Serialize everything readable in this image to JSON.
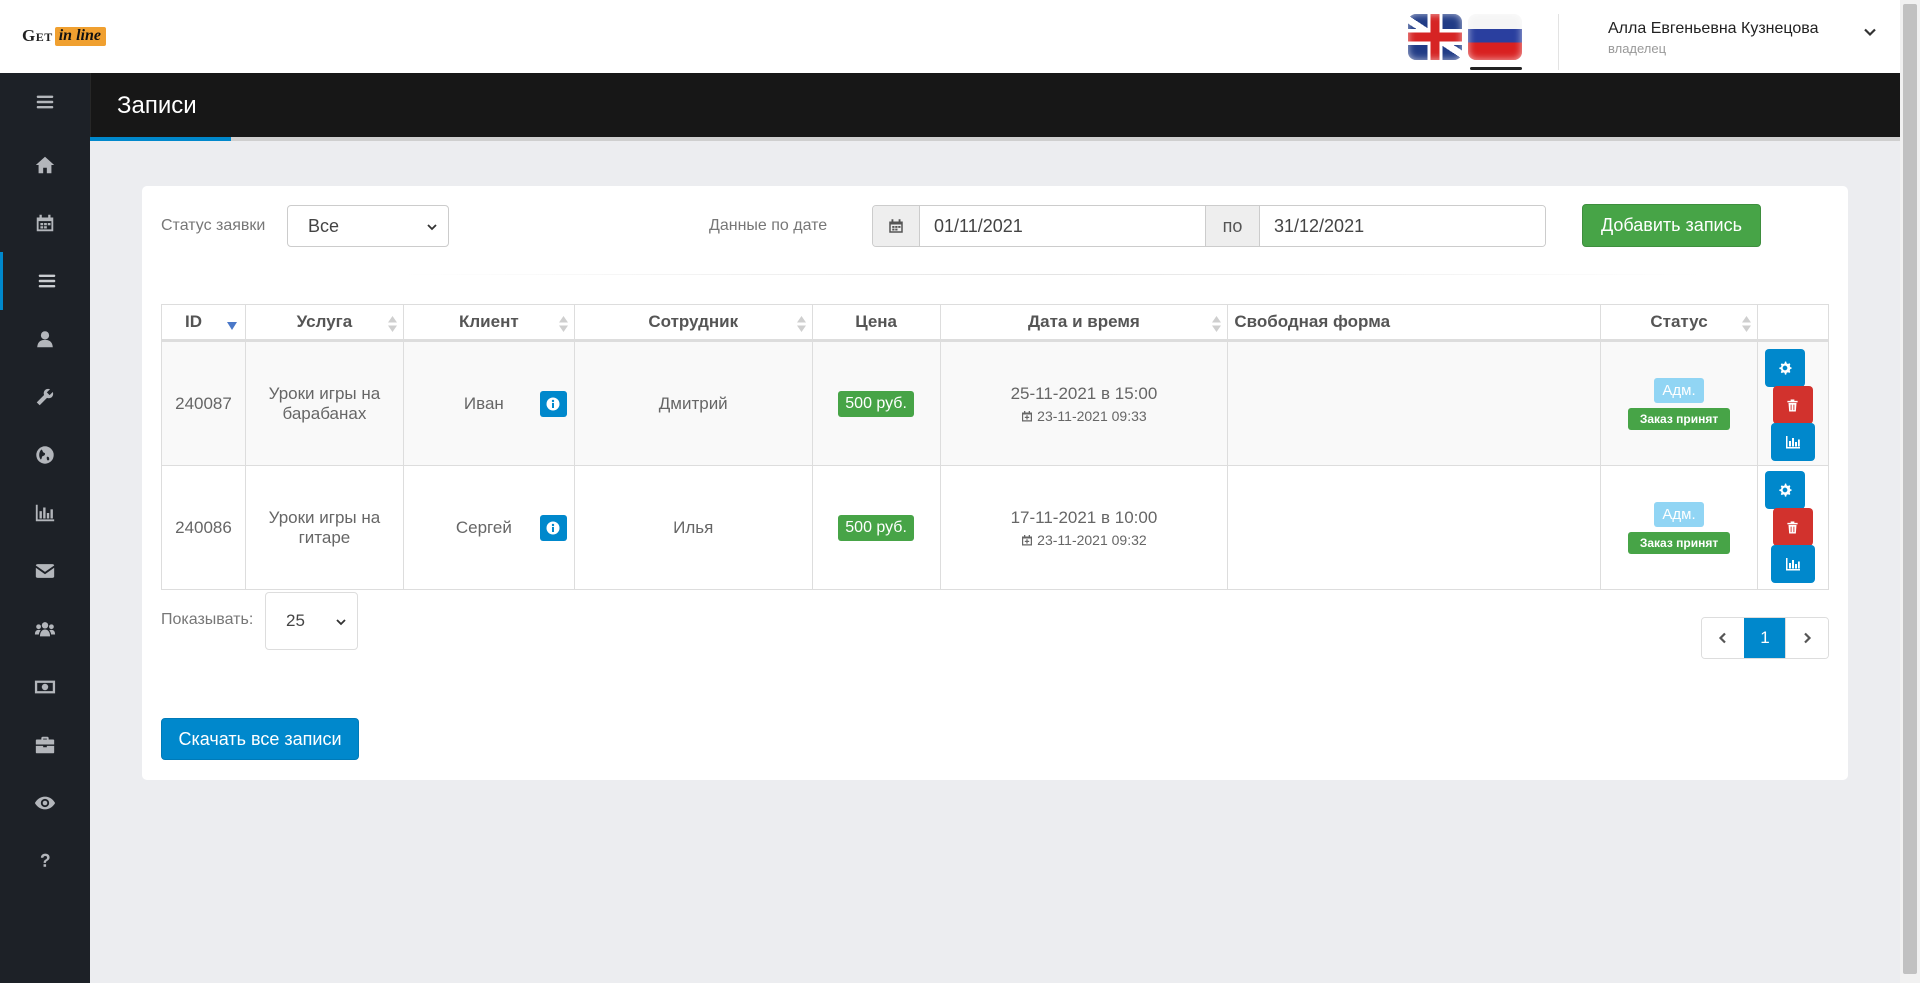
{
  "brand": {
    "logo_get": "Get",
    "logo_inline": "in line"
  },
  "topbar": {
    "user_name": "Алла Евгеньевна Кузнецова",
    "user_role": "владелец",
    "languages": [
      "english-flag-icon",
      "russian-flag-icon"
    ],
    "active_language": "russian-flag-icon"
  },
  "sidebar": {
    "items": [
      "menu-icon",
      "home-icon",
      "calendar-icon",
      "list-icon",
      "user-icon",
      "wrench-icon",
      "globe-icon",
      "bar-chart-icon",
      "envelope-icon",
      "users-icon",
      "money-icon",
      "briefcase-icon",
      "eye-icon",
      "question-icon"
    ],
    "active": "list-icon"
  },
  "page": {
    "title": "Записи"
  },
  "filters": {
    "status_label": "Статус заявки",
    "status_value": "Все",
    "date_label": "Данные по дате",
    "date_from": "01/11/2021",
    "date_sep": "по",
    "date_to": "31/12/2021",
    "add_button": "Добавить запись"
  },
  "table": {
    "columns": [
      "ID",
      "Услуга",
      "Клиент",
      "Сотрудник",
      "Цена",
      "Дата и время",
      "Свободная форма",
      "Статус",
      ""
    ],
    "rows": [
      {
        "id": "240087",
        "service": "Уроки игры на барабанах",
        "client": "Иван",
        "employee": "Дмитрий",
        "price": "500 руб.",
        "datetime": "25-11-2021 в 15:00",
        "created": "23-11-2021 09:33",
        "free_form": "",
        "status_source": "Адм.",
        "status": "Заказ принят"
      },
      {
        "id": "240086",
        "service": "Уроки игры на гитаре",
        "client": "Сергей",
        "employee": "Илья",
        "price": "500 руб.",
        "datetime": "17-11-2021 в 10:00",
        "created": "23-11-2021 09:32",
        "free_form": "",
        "status_source": "Адм.",
        "status": "Заказ принят"
      }
    ]
  },
  "pagination": {
    "show_label": "Показывать:",
    "page_size": "25",
    "current_page": "1"
  },
  "download_button": "Скачать все записи",
  "colors": {
    "primary": "#0088cc",
    "success": "#47a447",
    "danger": "#d2322d",
    "sidebar": "#1d2127",
    "header": "#171717"
  }
}
